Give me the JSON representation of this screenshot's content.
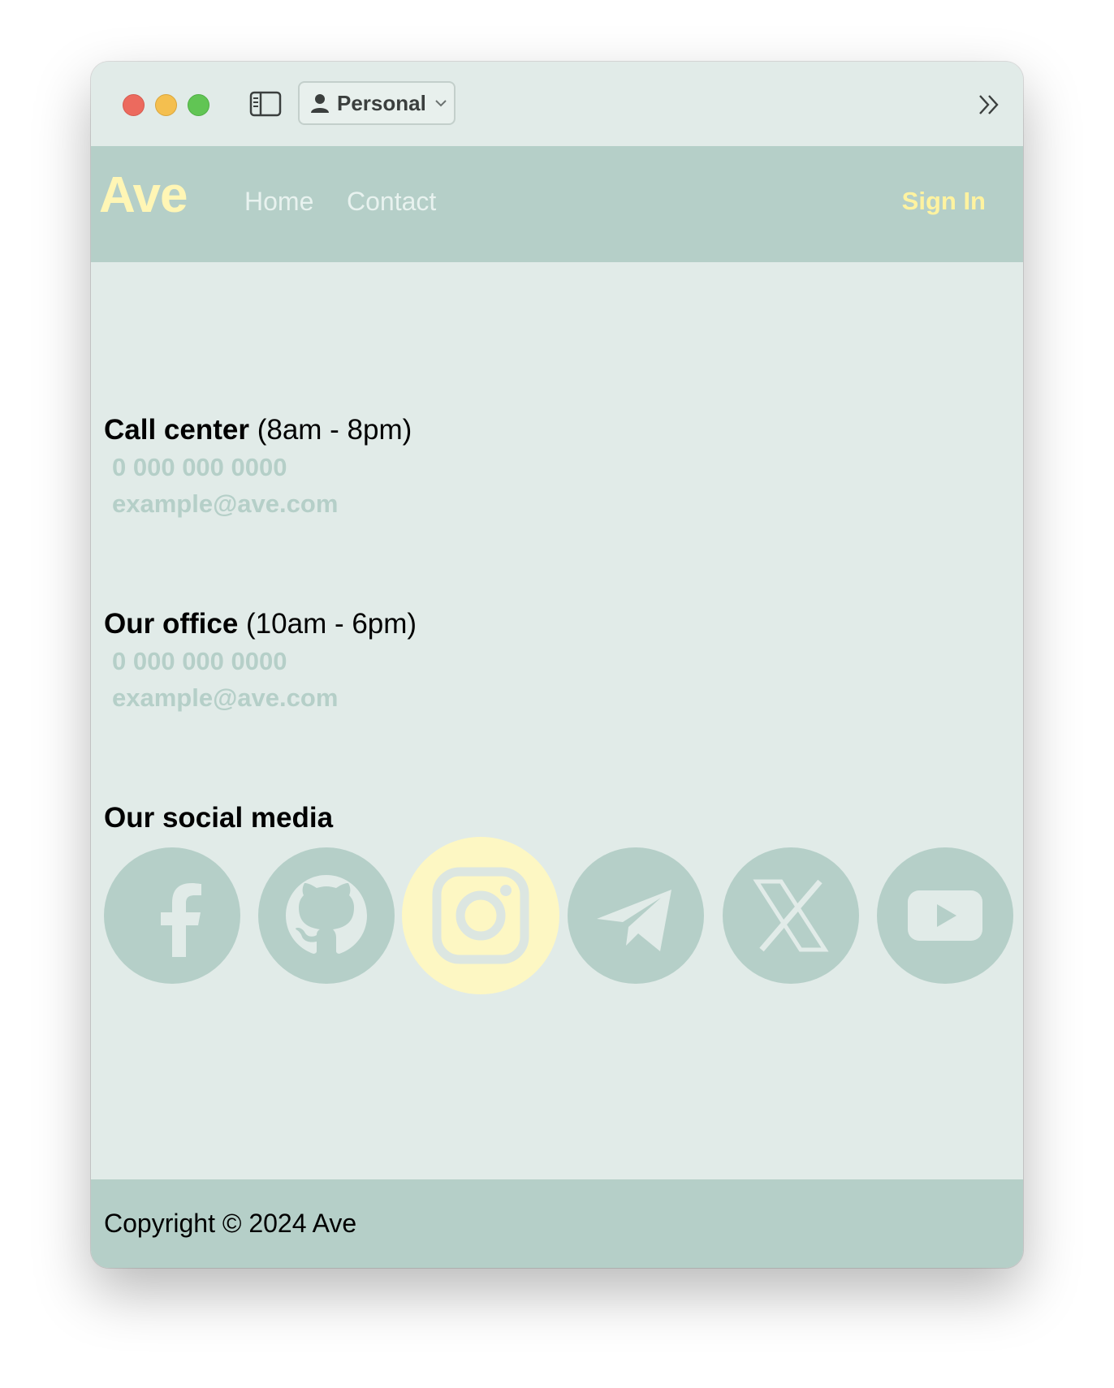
{
  "browser": {
    "profile_label": "Personal",
    "icons": {
      "sidebar": "sidebar-toggle-icon",
      "profile": "person-icon",
      "chevron": "chevron-down-icon",
      "more": "double-chevron-right-icon"
    }
  },
  "nav": {
    "brand": "Ave",
    "links": [
      "Home",
      "Contact"
    ],
    "signin": "Sign In"
  },
  "call_center": {
    "title": "Call center",
    "hours": "(8am - 8pm)",
    "phone": "0 000 000 0000",
    "email": "example@ave.com"
  },
  "office": {
    "title": "Our office",
    "hours": "(10am - 6pm)",
    "phone": "0 000 000 0000",
    "email": "example@ave.com"
  },
  "social": {
    "title": "Our social media",
    "items": [
      "facebook-icon",
      "github-icon",
      "instagram-icon",
      "telegram-icon",
      "x-icon",
      "youtube-icon"
    ],
    "highlighted": "instagram-icon"
  },
  "footer": {
    "copyright": "Copyright © 2024 Ave"
  },
  "colors": {
    "page_bg": "#e1ebe8",
    "accent": "#b5cfc8",
    "brand_yellow": "#fff6b5",
    "highlight": "#fdf7c3"
  }
}
